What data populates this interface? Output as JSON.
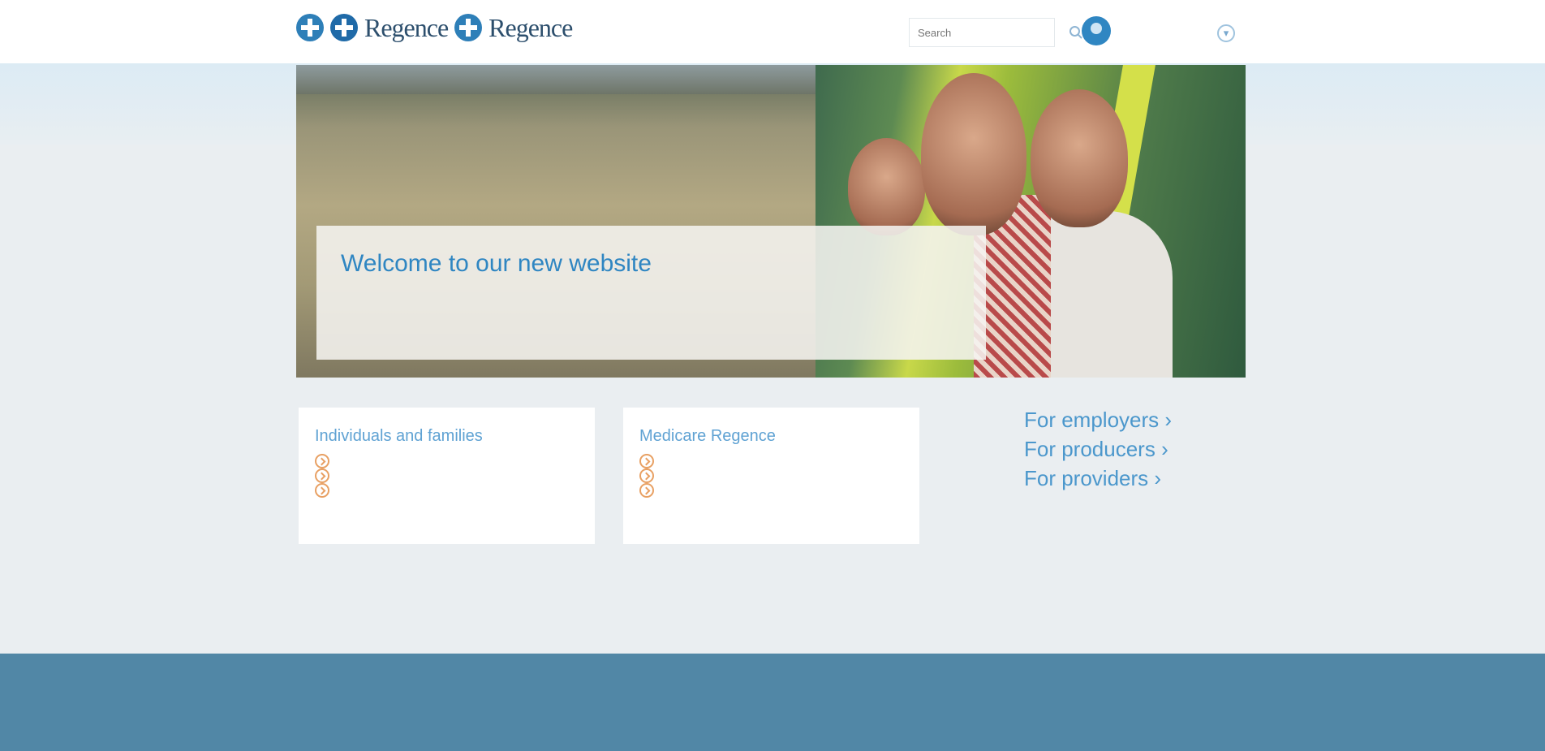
{
  "header": {
    "logo_text_1": "Regence",
    "logo_text_2": "Regence",
    "tagline": "",
    "search_placeholder": "Search",
    "account_name": "",
    "account_sub": ""
  },
  "hero": {
    "title": "Welcome to our new website",
    "body": "",
    "link": ""
  },
  "cards": [
    {
      "title": "Individuals and families",
      "items": [
        "",
        "",
        ""
      ]
    },
    {
      "title": "Medicare Regence",
      "items": [
        "",
        "",
        ""
      ]
    }
  ],
  "side_links": [
    "For employers ›",
    "For producers ›",
    "For providers ›"
  ],
  "bottom_links": [],
  "footer": {
    "left": "",
    "right": ""
  },
  "colors": {
    "accent": "#2f86c2",
    "orange": "#e8a063",
    "footer": "#5187a6"
  }
}
